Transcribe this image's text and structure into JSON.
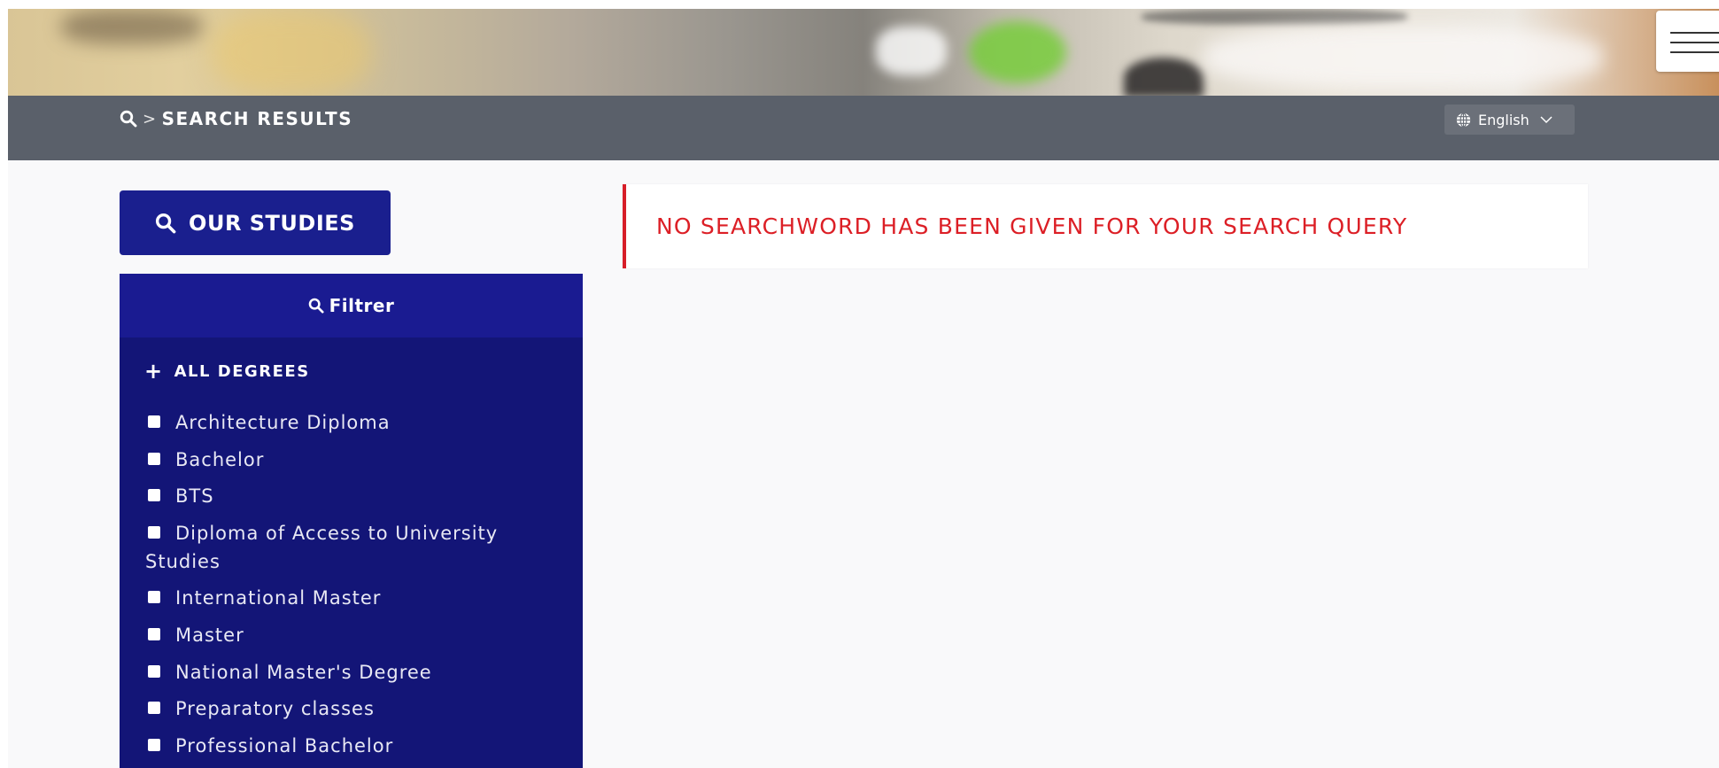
{
  "header": {
    "menu_icon": "hamburger-icon"
  },
  "breadcrumb": {
    "icon": "search-icon",
    "separator": ">",
    "current": "SEARCH RESULTS"
  },
  "language": {
    "icon": "globe-icon",
    "label": "English",
    "chevron": "chevron-down-icon"
  },
  "sidebar": {
    "studies_button": {
      "icon": "search-icon",
      "label": "OUR STUDIES"
    },
    "filter": {
      "title": {
        "icon": "search-icon",
        "label": "Filtrer"
      },
      "group_title": "ALL DEGREES",
      "group_icon": "plus-icon",
      "items": [
        "Architecture Diploma",
        "Bachelor",
        "BTS",
        "Diploma of Access to University Studies",
        "International Master",
        "Master",
        "National Master's Degree",
        "Preparatory classes",
        "Professional Bachelor"
      ]
    }
  },
  "main": {
    "message": "NO SEARCHWORD HAS BEEN GIVEN FOR YOUR SEARCH QUERY"
  },
  "colors": {
    "navy": "#131577",
    "button_blue": "#1a1f8e",
    "breadcrumb_bar": "#5a606a",
    "error_red": "#dc1f26"
  }
}
